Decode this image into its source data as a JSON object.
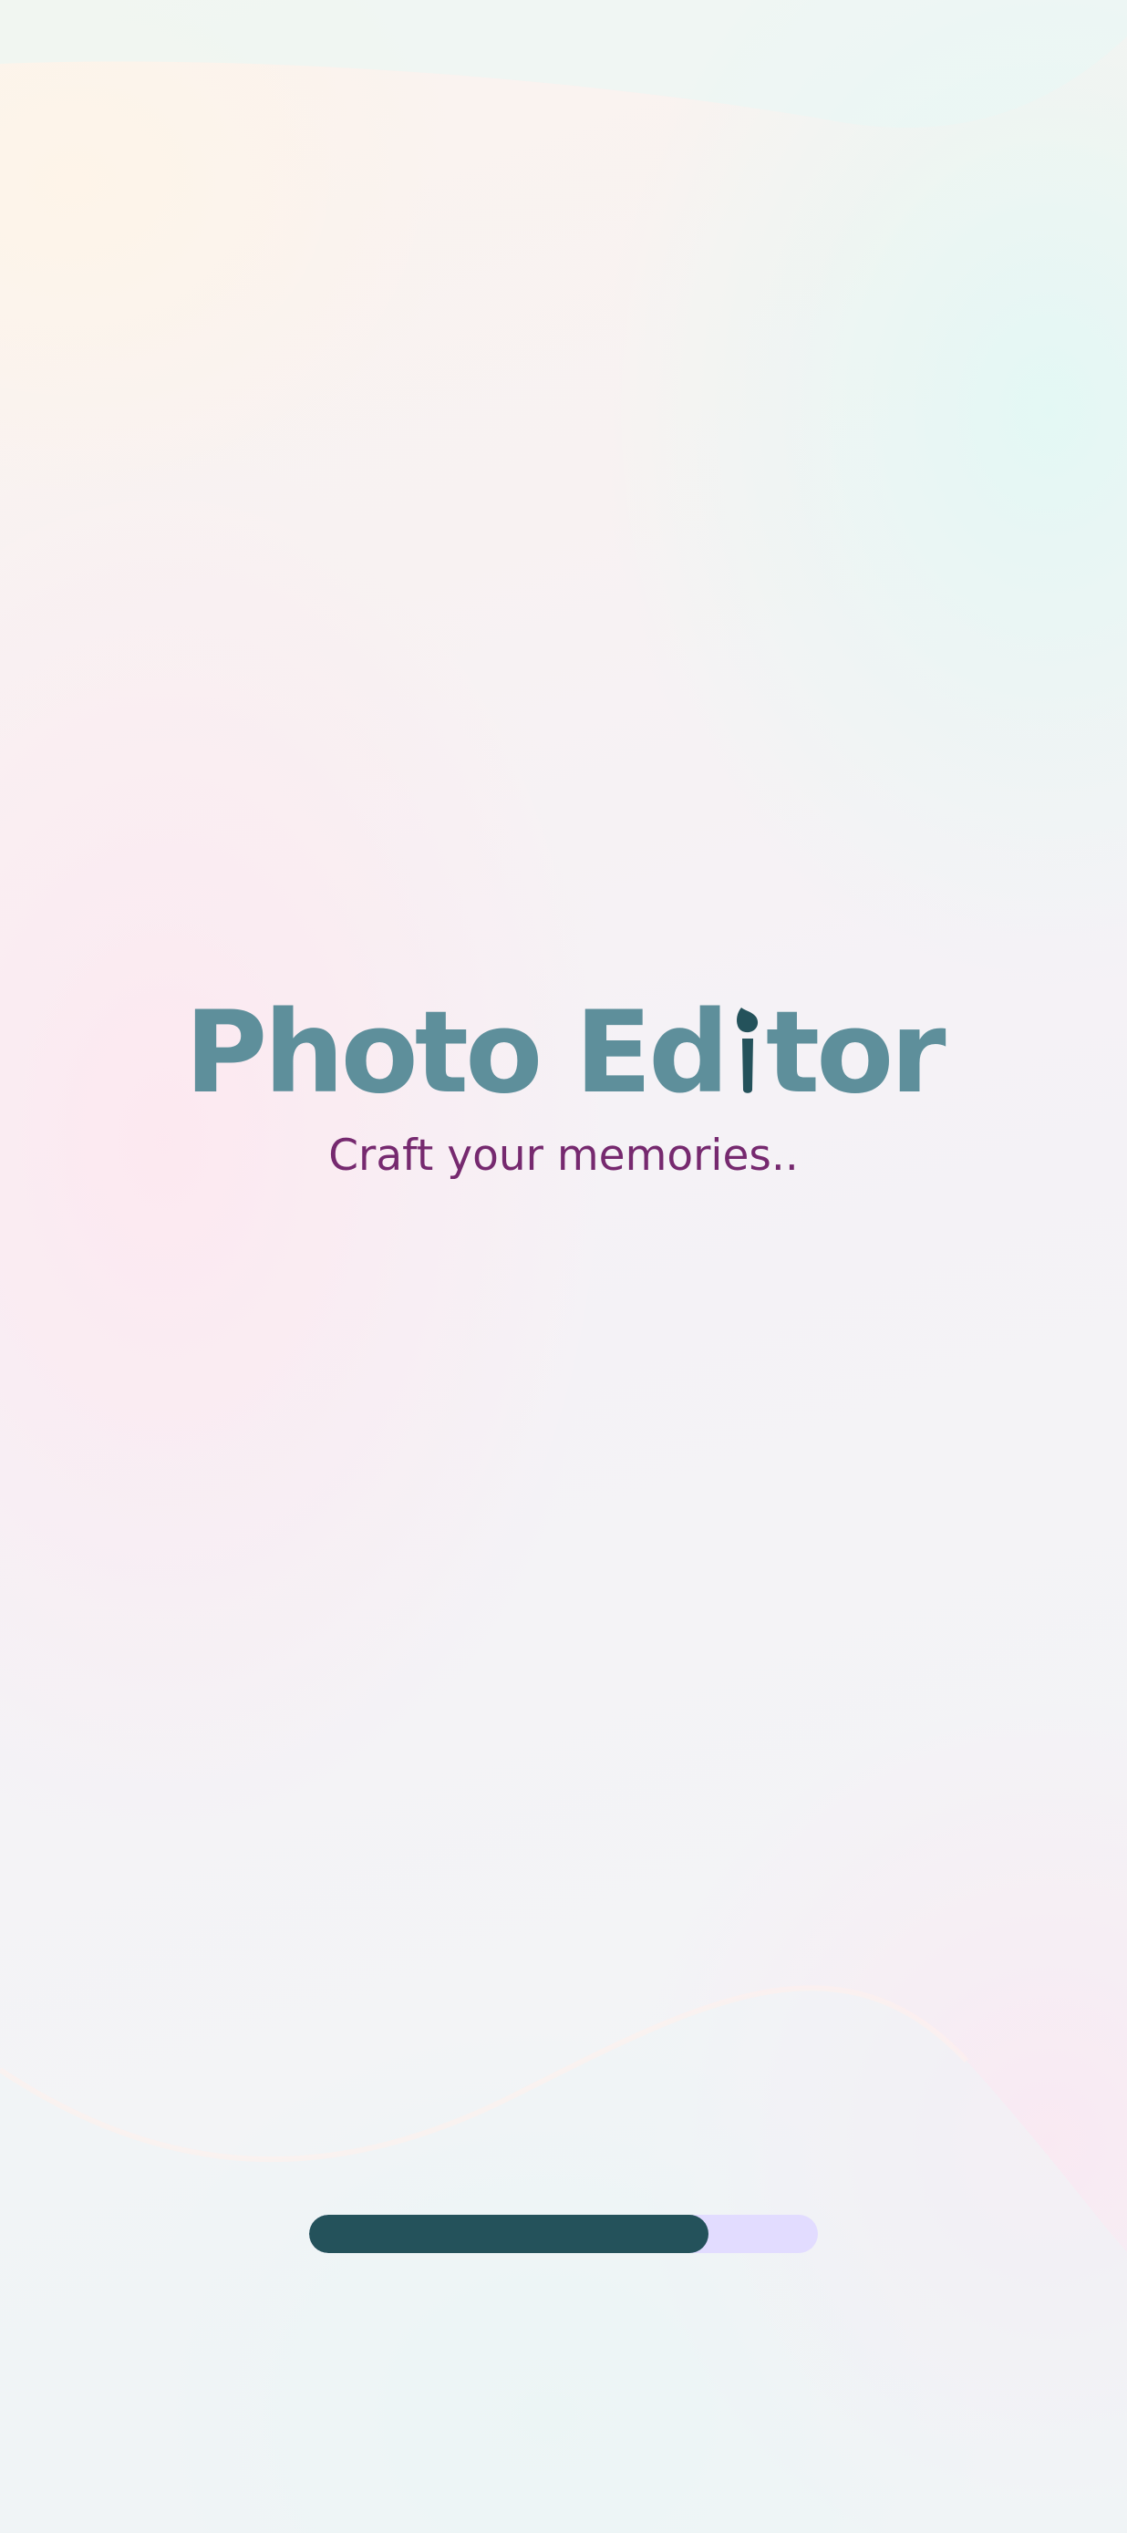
{
  "app": {
    "title_part1": "Photo Ed",
    "title_part2": "tor",
    "brush_icon": "paintbrush-icon",
    "tagline": "Craft your memories.."
  },
  "loading": {
    "progress": 0.785
  },
  "colors": {
    "title": "#5e8f9b",
    "tagline": "#76296f",
    "progress_fill": "#24525b",
    "progress_track": "#e2dcff",
    "brush": "#24525b"
  }
}
